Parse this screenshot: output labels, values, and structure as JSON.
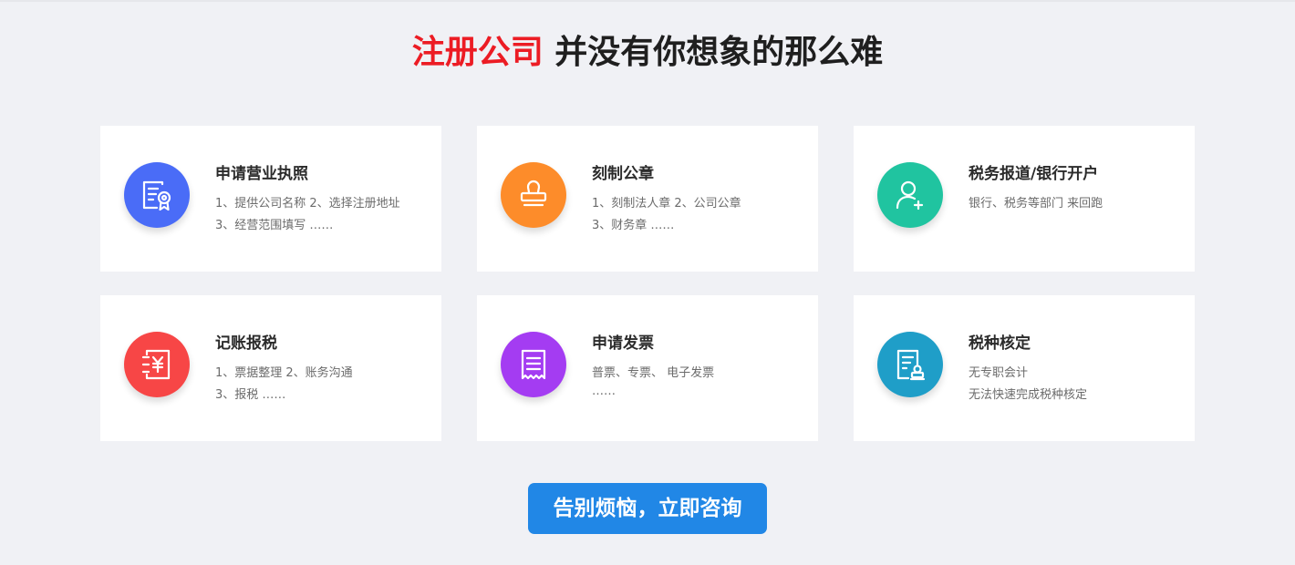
{
  "heading": {
    "highlight": "注册公司",
    "rest": " 并没有你想象的那么难",
    "highlight_color": "#ec1c24"
  },
  "services": [
    {
      "title": "申请营业执照",
      "lines": [
        "1、提供公司名称 2、选择注册地址",
        "3、经营范围填写 ……"
      ],
      "icon": "license-certificate-icon",
      "color": "#4a6cf7"
    },
    {
      "title": "刻制公章",
      "lines": [
        "1、刻制法人章 2、公司公章",
        "3、财务章 ……"
      ],
      "icon": "stamp-icon",
      "color": "#fd8c2a"
    },
    {
      "title": "税务报道/银行开户",
      "lines": [
        "银行、税务等部门 来回跑",
        ""
      ],
      "icon": "user-add-icon",
      "color": "#20c4a0"
    },
    {
      "title": "记账报税",
      "lines": [
        "1、票据整理 2、账务沟通",
        "3、报税 ……"
      ],
      "icon": "yuan-ledger-icon",
      "color": "#f74646"
    },
    {
      "title": "申请发票",
      "lines": [
        "普票、专票、 电子发票",
        "……"
      ],
      "icon": "invoice-receipt-icon",
      "color": "#a43cf2"
    },
    {
      "title": "税种核定",
      "lines": [
        "无专职会计",
        "无法快速完成税种核定"
      ],
      "icon": "tax-document-stamp-icon",
      "color": "#1f9ec8"
    }
  ],
  "cta": {
    "label": "告别烦恼，立即咨询",
    "color": "#2187e6"
  }
}
